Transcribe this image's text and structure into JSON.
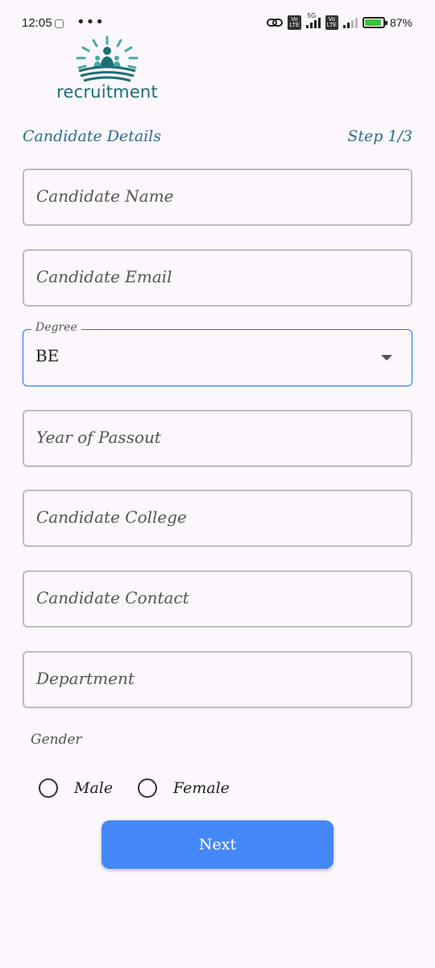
{
  "status_bar": {
    "time": "12:05",
    "overflow": "•••",
    "network_1": "5G",
    "volte": "Vo LTE",
    "battery_percent": "87%"
  },
  "logo": {
    "text": "recruitment",
    "icon": "recruitment-logo-icon",
    "colors": {
      "rays": "#49a9a6",
      "figure": "#1d6e75"
    }
  },
  "header": {
    "title": "Candidate Details",
    "step": "Step 1/3"
  },
  "form": {
    "candidate_name_placeholder": "Candidate Name",
    "candidate_email_placeholder": "Candidate Email",
    "degree_label": "Degree",
    "degree_value": "BE",
    "year_of_passout_placeholder": "Year of Passout",
    "candidate_college_placeholder": "Candidate College",
    "candidate_contact_placeholder": "Candidate Contact",
    "department_placeholder": "Department",
    "gender_label": "Gender",
    "gender_options": [
      "Male",
      "Female"
    ]
  },
  "actions": {
    "next_label": "Next"
  },
  "colors": {
    "background": "#fcf6fd",
    "accent": "#2a6f8a",
    "primary_button": "#4488f8",
    "focus_border": "#1a73e8"
  }
}
